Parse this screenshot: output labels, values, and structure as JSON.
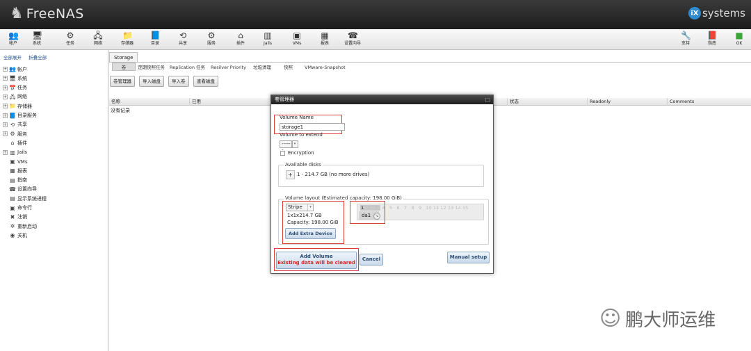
{
  "app": {
    "brand": "FreeNAS",
    "vendor": "iXsystems",
    "vendor_mark": "iX",
    "vendor_text": "systems"
  },
  "toolbar": {
    "items": [
      {
        "label": "帐户",
        "icon": "users-icon"
      },
      {
        "label": "系统",
        "icon": "system-icon"
      },
      {
        "label": "任务",
        "icon": "tasks-icon"
      },
      {
        "label": "网络",
        "icon": "network-icon"
      },
      {
        "label": "存储器",
        "icon": "storage-icon"
      },
      {
        "label": "目录",
        "icon": "directory-icon"
      },
      {
        "label": "共享",
        "icon": "sharing-icon"
      },
      {
        "label": "服务",
        "icon": "services-icon"
      },
      {
        "label": "插件",
        "icon": "plugins-icon"
      },
      {
        "label": "Jails",
        "icon": "jails-icon"
      },
      {
        "label": "VMs",
        "icon": "vms-icon"
      },
      {
        "label": "报表",
        "icon": "reporting-icon"
      },
      {
        "label": "设置向导",
        "icon": "wizard-icon"
      }
    ],
    "right_items": [
      {
        "label": "支持",
        "icon": "support-icon"
      },
      {
        "label": "指南",
        "icon": "guide-icon"
      },
      {
        "label": "OK",
        "icon": "alert-ok-icon"
      }
    ]
  },
  "sidebar": {
    "expand_all": "全部展开",
    "collapse_all": "折叠全部",
    "items": [
      {
        "label": "帐户",
        "expandable": true
      },
      {
        "label": "系统",
        "expandable": true
      },
      {
        "label": "任务",
        "expandable": true
      },
      {
        "label": "网络",
        "expandable": true
      },
      {
        "label": "存储器",
        "expandable": true
      },
      {
        "label": "目录服务",
        "expandable": true
      },
      {
        "label": "共享",
        "expandable": true
      },
      {
        "label": "服务",
        "expandable": true
      },
      {
        "label": "插件",
        "expandable": false
      },
      {
        "label": "Jails",
        "expandable": true
      },
      {
        "label": "VMs",
        "expandable": false
      },
      {
        "label": "报表",
        "expandable": false
      },
      {
        "label": "指南",
        "expandable": false
      },
      {
        "label": "设置向导",
        "expandable": false
      },
      {
        "label": "显示系统进程",
        "expandable": false
      },
      {
        "label": "命令行",
        "expandable": false
      },
      {
        "label": "注销",
        "expandable": false
      },
      {
        "label": "重新启动",
        "expandable": false
      },
      {
        "label": "关机",
        "expandable": false
      }
    ]
  },
  "main": {
    "tab": "Storage",
    "subtabs": [
      "卷",
      "定期快照任务",
      "Replication 任务",
      "Resilver Priority",
      "垃圾清理",
      "快照",
      "VMware-Snapshot"
    ],
    "buttons": [
      "卷管理器",
      "导入磁盘",
      "导入卷",
      "查看磁盘"
    ],
    "columns": [
      "名称",
      "已用",
      "状态",
      "Readonly",
      "Comments"
    ],
    "empty_text": "没有记录"
  },
  "dialog": {
    "title": "卷管理器",
    "volume_name_label": "Volume Name",
    "volume_name_value": "storage1",
    "extend_label": "Volume to extend",
    "extend_value": "------",
    "encryption_label": "Encryption",
    "available_disks_legend": "Available disks",
    "available_disks_text": "1 - 214.7 GB (no more drives)",
    "layout_legend": "Volume layout (Estimated capacity: 198.00 GiB)",
    "layout_type": "Stripe",
    "layout_geometry": "1x1x214.7 GB",
    "layout_capacity": "Capacity: 198.00 GiB",
    "add_extra_device": "Add Extra Device",
    "grid_numbers": [
      "1",
      "2",
      "3",
      "4",
      "5",
      "6",
      "7",
      "8",
      "9",
      "10",
      "11",
      "12",
      "13",
      "14",
      "15"
    ],
    "disk_name": "da1",
    "add_volume_line1": "Add Volume",
    "add_volume_line2": "Existing data will be cleared",
    "cancel": "Cancel",
    "manual_setup": "Manual setup"
  },
  "watermark": {
    "text": "鹏大师运维"
  },
  "colors": {
    "header_bg": "#2a2a2a",
    "warning_red": "#d62828",
    "highlight_red": "#e23b3b",
    "link_blue": "#1a4e8a"
  }
}
